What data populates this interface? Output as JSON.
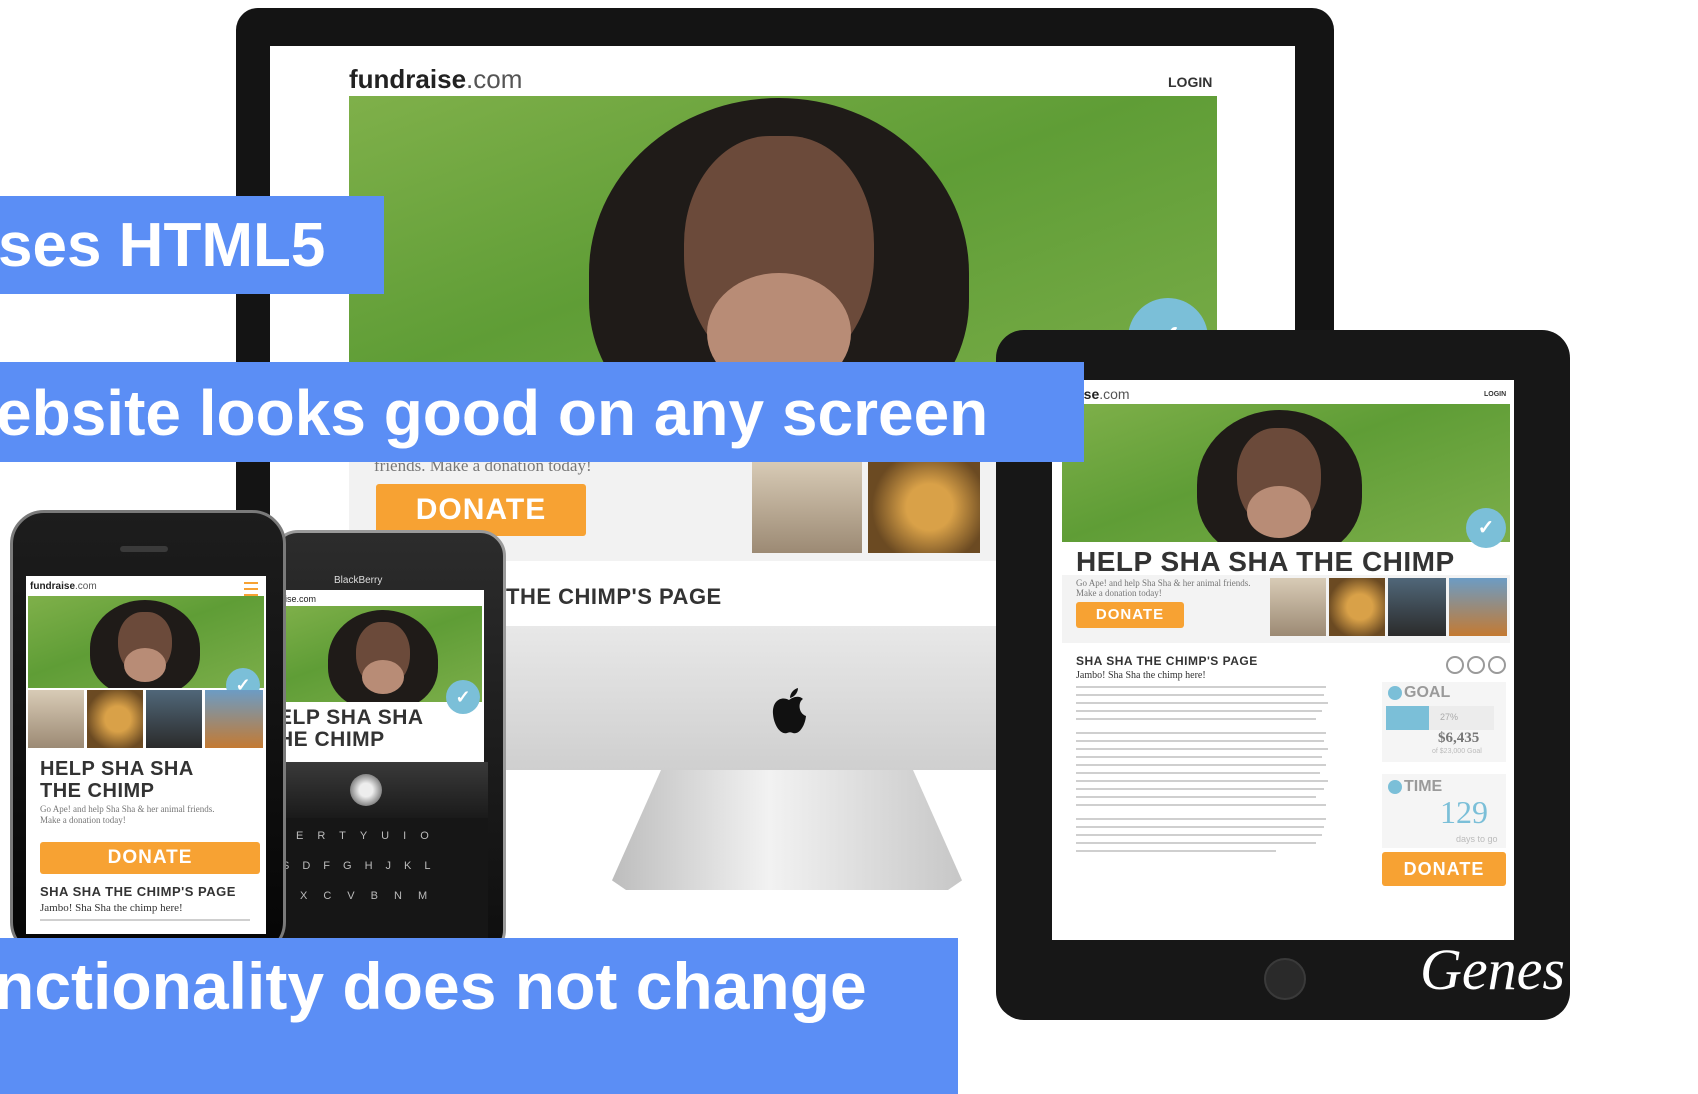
{
  "site": {
    "logo_name": "fundraise",
    "logo_tld": ".com",
    "login": "LOGIN",
    "headline": "HELP SHA SHA THE CHIMP",
    "tagline": "Go Ape! and help Sha Sha & her animal friends. Make a donation today!",
    "desktop_tagline_fragment": "friends. Make a donation today!",
    "donate": "DONATE",
    "page_title": "SHA SHA THE CHIMP'S PAGE",
    "desktop_page_title_fragment": "THE CHIMP'S PAGE",
    "intro": "Jambo! Sha Sha the chimp here!",
    "goal_label": "GOAL",
    "goal_percent": "27%",
    "goal_amount": "$6,435",
    "goal_sub": "of $23,000 Goal",
    "time_label": "TIME",
    "time_days": "129",
    "time_sub": "days to go"
  },
  "phone": {
    "title_line1": "HELP SHA SHA",
    "title_line2": "THE CHIMP"
  },
  "blackberry": {
    "brand": "BlackBerry",
    "logo_fragment": "aise.com",
    "title_line1": "ELP SHA SHA",
    "title_line2": "HE CHIMP",
    "keys_row1": [
      "E",
      "R",
      "T",
      "Y",
      "U",
      "I",
      "O"
    ],
    "keys_row2": [
      "S",
      "D",
      "F",
      "G",
      "H",
      "J",
      "K",
      "L"
    ],
    "keys_row3": [
      "X",
      "C",
      "V",
      "B",
      "N",
      "M"
    ]
  },
  "tablet": {
    "logo_fragment": "draise",
    "login": "LOGIN"
  },
  "banners": {
    "html5": "ses HTML5",
    "any_screen": "ebsite looks good on any screen",
    "functionality": "nctionality does not change"
  },
  "watermark": "Genes",
  "goal_progress_fraction": 0.27,
  "colors": {
    "banner": "#5b8ef5",
    "donate": "#f7a233",
    "check": "#7bbfd8"
  },
  "icons": [
    "apple-icon",
    "check-badge-icon",
    "social-icons",
    "trackball-icon",
    "home-button-icon"
  ]
}
